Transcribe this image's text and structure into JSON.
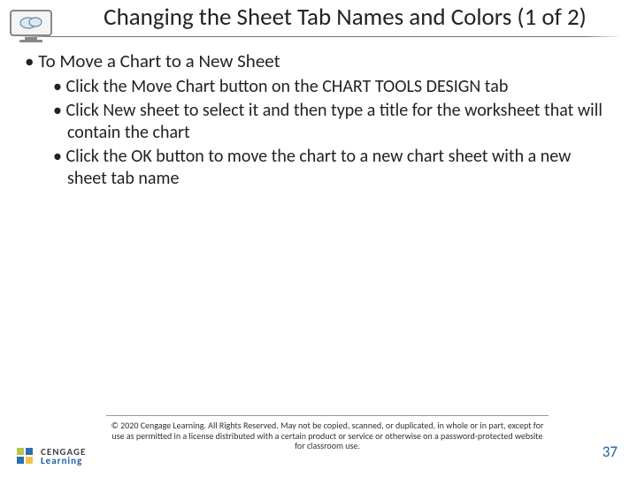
{
  "header": {
    "title": "Changing the Sheet Tab Names and Colors (1 of 2)"
  },
  "body": {
    "lvl1": "To Move a Chart to a New Sheet",
    "lvl2": [
      "Click the Move Chart button on the CHART TOOLS DESIGN tab",
      "Click New sheet to select it and then type a title for the worksheet that will contain the chart",
      "Click the OK button to move the chart to a new chart sheet with a new sheet tab name"
    ]
  },
  "footer": {
    "copyright": "© 2020 Cengage Learning. All Rights Reserved. May not be copied, scanned, or duplicated, in whole or in part, except for use as permitted in a license distributed with a certain product or service or otherwise on a password-protected website for classroom use.",
    "page": "37",
    "brand_line1": "CENGAGE",
    "brand_line2": "Learning"
  }
}
